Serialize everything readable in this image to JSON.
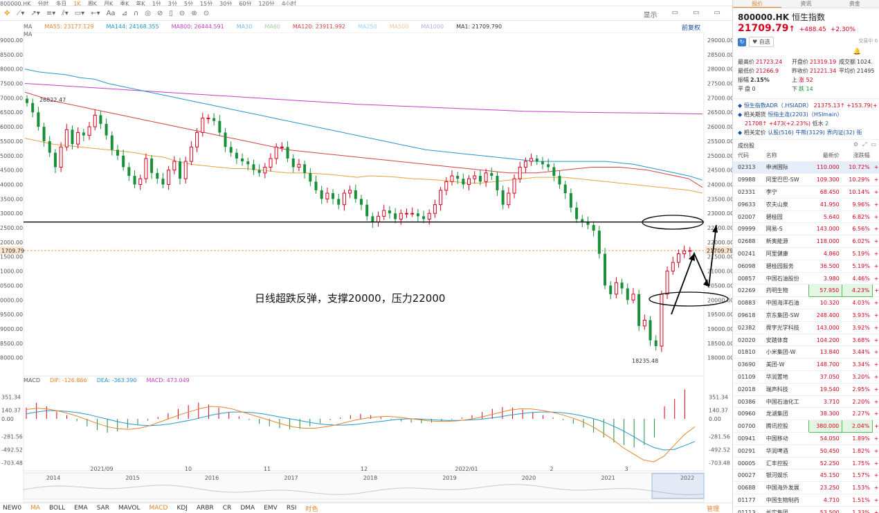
{
  "top_tabs": [
    "800000.HK",
    "分时",
    "多日",
    "1K",
    "周K",
    "月K",
    "季K",
    "年K",
    "1分",
    "3分",
    "5分",
    "15分",
    "30分",
    "60分",
    "120分",
    "4小时"
  ],
  "toolbar": {
    "right": [
      "显示",
      "▭",
      "▭",
      "▭"
    ]
  },
  "ma_legend": [
    {
      "label": "MA",
      "color": "#666666"
    },
    {
      "label": "MA55: 23177.129",
      "color": "#e8832a"
    },
    {
      "label": "MA144: 24168.355",
      "color": "#2196c9"
    },
    {
      "label": "MA800: 26444.591",
      "color": "#c040c0"
    },
    {
      "label": "MA30",
      "color": "#7ab8e8"
    },
    {
      "label": "MA60",
      "color": "#a0d4a0"
    },
    {
      "label": "MA120: 23911.992",
      "color": "#d84040"
    },
    {
      "label": "MA250",
      "color": "#9cd4f0"
    },
    {
      "label": "MA500",
      "color": "#f0c890"
    },
    {
      "label": "MA1000",
      "color": "#b0b0e0"
    },
    {
      "label": "MA1: 21709.790",
      "color": "#333333"
    }
  ],
  "ma2_label": "MA",
  "restore_label": "前复权",
  "price_axis": {
    "left": [
      "9000.00",
      "8500.00",
      "8000.00",
      "7500.00",
      "7000.00",
      "6500.00",
      "6000.00",
      "5500.00",
      "5000.00",
      "4500.00",
      "4000.00",
      "3500.00",
      "3000.00",
      "2500.00",
      "2000.00",
      "1500.00",
      "1000.00",
      "0500.00",
      "0000.00",
      "9500.00",
      "9000.00",
      "8500.00",
      "8000.00"
    ],
    "right": [
      "29000.00",
      "28500.00",
      "28000.00",
      "27500.00",
      "27000.00",
      "26500.00",
      "26000.00",
      "25500.00",
      "25000.00",
      "24500.00",
      "24000.00",
      "23500.00",
      "23000.00",
      "22500.00",
      "22000.00",
      "21500.00",
      "21000.00",
      "20500.00",
      "20000.00",
      "19500.00",
      "19000.00",
      "18500.00",
      "18000.00"
    ],
    "left_current": "1709.79",
    "right_current": "21709.79"
  },
  "chart_annotations": {
    "high_label": "26822.47",
    "low_label": "18235.48",
    "note": "日线超跌反弹，支撑20000，压力22000"
  },
  "macd_legend": [
    {
      "label": "MACD",
      "color": "#555555"
    },
    {
      "label": "DIF: -126.866",
      "color": "#e8832a"
    },
    {
      "label": "DEA: -363.390",
      "color": "#2196c9"
    },
    {
      "label": "MACD: 473.049",
      "color": "#c040c0"
    }
  ],
  "macd_axis": {
    "labels": [
      "351.34",
      "140.37",
      "0.00",
      "-281.56",
      "-492.52",
      "-703.48"
    ]
  },
  "date_axis": [
    "2021/09",
    "10",
    "11",
    "12",
    "2022/01",
    "2",
    "3"
  ],
  "overview_years": [
    "2014",
    "2015",
    "2016",
    "2017",
    "2018",
    "2019",
    "2020",
    "2021",
    "2022"
  ],
  "indicator_bar": [
    "NEW0",
    "MA",
    "BOLL",
    "EMA",
    "SAR",
    "MAVOL",
    "MACD",
    "KDJ",
    "ARBR",
    "CR",
    "DMA",
    "EMV",
    "RSI",
    "时色"
  ],
  "indicator_manage": "管理",
  "chart_data": {
    "type": "candlestick",
    "price_range": [
      17800,
      29000
    ],
    "current_price": 21709.79,
    "support": 20000,
    "resistance": 22000,
    "horizontal_line": 22700,
    "high": 26822.47,
    "low": 18235.48,
    "closes": [
      26822,
      26500,
      26000,
      25500,
      25100,
      24600,
      25300,
      25900,
      25400,
      25800,
      25700,
      26000,
      26400,
      26100,
      25700,
      25200,
      25000,
      24600,
      24300,
      24000,
      24200,
      24900,
      24400,
      24200,
      24000,
      24500,
      24800,
      24200,
      24800,
      25300,
      25800,
      26300,
      26300,
      26200,
      25800,
      25300,
      25100,
      24900,
      24800,
      24700,
      24500,
      24400,
      24600,
      24900,
      25300,
      25300,
      24900,
      24600,
      24700,
      24400,
      24100,
      23800,
      23500,
      23700,
      23500,
      23300,
      23700,
      23800,
      23500,
      23300,
      22900,
      22700,
      22900,
      23100,
      23000,
      22800,
      23000,
      23000,
      23000,
      22900,
      22800,
      23000,
      23300,
      23800,
      24100,
      24300,
      24200,
      24000,
      24200,
      24300,
      24100,
      24400,
      24300,
      23800,
      23300,
      23700,
      24200,
      24600,
      24800,
      24900,
      24800,
      24700,
      24600,
      24300,
      24000,
      23700,
      23200,
      22800,
      22700,
      22600,
      22400,
      21600,
      20500,
      20200,
      20600,
      20400,
      20000,
      20200,
      19100,
      19300,
      18600,
      18400,
      20200,
      21000,
      21300,
      21600,
      21700,
      21710
    ],
    "ma55": [
      25600,
      25500,
      25400,
      25350,
      25300,
      25250,
      25200,
      25150,
      25100,
      25000,
      24950,
      24800,
      24700,
      24650,
      24600,
      24550,
      24550,
      24500,
      24450,
      24400,
      24400,
      24380,
      24350,
      24300,
      24250,
      24300,
      24280,
      24250,
      24200,
      24180,
      24150,
      24100,
      24050,
      24050,
      24100,
      24150,
      24200,
      24250,
      24250,
      24250,
      24200,
      24150,
      24100,
      24050,
      24000,
      23950,
      23900,
      23850,
      23800,
      23700
    ],
    "ma120": [
      27200,
      27050,
      26900,
      26800,
      26700,
      26600,
      26500,
      26400,
      26300,
      26200,
      26100,
      26000,
      25900,
      25800,
      25700,
      25600,
      25500,
      25400,
      25300,
      25200,
      25150,
      25100,
      25050,
      25000,
      24950,
      24900,
      24850,
      24800,
      24750,
      24700,
      24650,
      24600,
      24550,
      24500,
      24450,
      24400,
      24400,
      24400,
      24450,
      24500,
      24550,
      24600,
      24600,
      24600,
      24550,
      24500,
      24400,
      24300,
      24200,
      23900
    ],
    "ma144": [
      28000,
      27900,
      27850,
      27800,
      27700,
      27650,
      27500,
      27400,
      27300,
      27200,
      27100,
      27000,
      26900,
      26800,
      26700,
      26600,
      26500,
      26400,
      26300,
      26200,
      26100,
      26000,
      25900,
      25800,
      25700,
      25600,
      25500,
      25400,
      25300,
      25200,
      25150,
      25100,
      25050,
      25000,
      24950,
      24900,
      24850,
      24800,
      24800,
      24800,
      24800,
      24800,
      24800,
      24750,
      24700,
      24600,
      24500,
      24400,
      24300,
      24150
    ],
    "ma800": [
      27500,
      27470,
      27440,
      27410,
      27380,
      27350,
      27320,
      27290,
      27260,
      27230,
      27200,
      27170,
      27140,
      27110,
      27080,
      27050,
      27020,
      26990,
      26960,
      26930,
      26900,
      26870,
      26840,
      26810,
      26780,
      26760,
      26740,
      26720,
      26700,
      26680,
      26660,
      26640,
      26620,
      26600,
      26580,
      26560,
      26540,
      26530,
      26520,
      26510,
      26500,
      26495,
      26490,
      26485,
      26480,
      26475,
      26470,
      26460,
      26450,
      26444
    ],
    "macd_hist": [
      180,
      260,
      200,
      120,
      60,
      -40,
      -120,
      -180,
      -220,
      -200,
      -150,
      -90,
      -30,
      30,
      90,
      160,
      220,
      260,
      230,
      180,
      110,
      40,
      -20,
      -80,
      -120,
      -150,
      -170,
      -160,
      -120,
      -70,
      -20,
      20,
      60,
      80,
      60,
      30,
      -10,
      -40,
      -60,
      -70,
      -60,
      -40,
      -10,
      20,
      60,
      110,
      160,
      190,
      180,
      150,
      100,
      60,
      20,
      -20,
      -80,
      -140,
      -220,
      -300,
      -380,
      -420,
      -460,
      -420,
      -300,
      200,
      320,
      473
    ],
    "dif": [
      150,
      170,
      160,
      130,
      90,
      40,
      -20,
      -80,
      -130,
      -160,
      -170,
      -150,
      -110,
      -50,
      10,
      70,
      120,
      170,
      200,
      190,
      160,
      110,
      60,
      10,
      -40,
      -90,
      -130,
      -150,
      -150,
      -130,
      -100,
      -60,
      -20,
      10,
      30,
      40,
      30,
      10,
      -10,
      -30,
      -40,
      -40,
      -30,
      -10,
      20,
      60,
      100,
      140,
      160,
      160,
      140,
      110,
      70,
      20,
      -40,
      -120,
      -220,
      -330,
      -460,
      -560,
      -660,
      -690,
      -600,
      -420,
      -250,
      -127
    ],
    "dea": [
      80,
      110,
      130,
      130,
      120,
      100,
      70,
      30,
      -10,
      -50,
      -80,
      -100,
      -110,
      -100,
      -80,
      -50,
      -20,
      20,
      60,
      90,
      110,
      110,
      100,
      80,
      50,
      20,
      -10,
      -40,
      -70,
      -90,
      -100,
      -100,
      -90,
      -70,
      -50,
      -30,
      -10,
      0,
      0,
      -10,
      -20,
      -25,
      -25,
      -20,
      -10,
      10,
      30,
      60,
      80,
      100,
      110,
      110,
      100,
      80,
      50,
      10,
      -40,
      -110,
      -190,
      -280,
      -380,
      -460,
      -500,
      -490,
      -430,
      -363
    ]
  },
  "rp": {
    "tabs": [
      "报价",
      "资讯",
      "资金"
    ],
    "code": "800000.HK",
    "name": "恒生指数",
    "price": "21709.79",
    "arrow": "↑",
    "change": "+488.45",
    "change_pct": "+2.30%",
    "trade_status": "交易中 0",
    "fav_label": "自选",
    "quote": [
      [
        "最高价",
        "21723.24",
        "开盘价",
        "21319.19",
        "成交额",
        "1024."
      ],
      [
        "最低价",
        "21266.9",
        "昨收价",
        "21221.34",
        "平均价",
        "21495"
      ],
      [
        "振幅",
        "2.15%",
        "上",
        "涨 52",
        "",
        ""
      ],
      [
        "平",
        "盘 0",
        "下",
        "跌 14",
        "",
        ""
      ]
    ],
    "related": {
      "adr_label": "恒生指数ADR（.HSIADR）",
      "adr_price": "21375.13",
      "adr_change": "+153.79(+",
      "fut_label": "相关期货",
      "fut_name": "恒指主连(2203)（HSImain）",
      "fut_price": "21708",
      "fut_change": "+473(+2.23%)",
      "fut_low_label": "低水",
      "fut_low": "2",
      "plate_label": "相关定价",
      "plate_items": [
        "认股(516)",
        "牛熊(3129)",
        "界内证(32)",
        "街"
      ]
    },
    "comp_title": "成份股",
    "table_headers": [
      "代码",
      "名称",
      "最新价",
      "涨跌幅"
    ],
    "rows": [
      [
        "02313",
        "申洲国际",
        "110.000",
        "10.72%"
      ],
      [
        "09988",
        "阿里巴巴-SW",
        "109.300",
        "10.29%"
      ],
      [
        "02331",
        "李宁",
        "68.450",
        "10.14%"
      ],
      [
        "09633",
        "农夫山泉",
        "41.950",
        "9.96%"
      ],
      [
        "02007",
        "碧桂园",
        "5.640",
        "6.82%"
      ],
      [
        "09999",
        "网易-S",
        "143.000",
        "6.56%"
      ],
      [
        "02688",
        "新奥能源",
        "118.000",
        "6.02%"
      ],
      [
        "00241",
        "阿里健康",
        "4.860",
        "5.19%"
      ],
      [
        "06098",
        "碧桂园服务",
        "36.500",
        "5.19%"
      ],
      [
        "00857",
        "中国石油股份",
        "3.980",
        "4.46%"
      ],
      [
        "02269",
        "药明生物",
        "57.950",
        "4.23%"
      ],
      [
        "00883",
        "中国海洋石油",
        "10.320",
        "4.03%"
      ],
      [
        "09618",
        "京东集团-SW",
        "248.400",
        "3.93%"
      ],
      [
        "02382",
        "舜宇光学科技",
        "143.000",
        "3.92%"
      ],
      [
        "02020",
        "安踏体育",
        "104.200",
        "3.68%"
      ],
      [
        "01810",
        "小米集团-W",
        "13.840",
        "3.44%"
      ],
      [
        "03690",
        "美团-W",
        "148.700",
        "3.34%"
      ],
      [
        "01109",
        "华润置地",
        "37.050",
        "3.20%"
      ],
      [
        "02018",
        "瑞声科技",
        "19.540",
        "2.95%"
      ],
      [
        "00386",
        "中国石油化工",
        "3.710",
        "2.20%"
      ],
      [
        "00960",
        "龙湖集团",
        "38.300",
        "2.27%"
      ],
      [
        "00700",
        "腾讯控股",
        "380.000",
        "2.04%"
      ],
      [
        "00941",
        "中国移动",
        "54.050",
        "1.89%"
      ],
      [
        "00291",
        "华润啤酒",
        "50.450",
        "1.82%"
      ],
      [
        "00005",
        "汇丰控股",
        "52.250",
        "1.75%"
      ],
      [
        "00027",
        "银河娱乐",
        "45.150",
        "1.57%"
      ],
      [
        "00688",
        "中国海外发展",
        "23.250",
        "1.53%"
      ],
      [
        "01177",
        "中国生物制药",
        "4.710",
        "1.51%"
      ],
      [
        "01113",
        "长实集团",
        "53.500",
        "1.33%"
      ]
    ]
  }
}
